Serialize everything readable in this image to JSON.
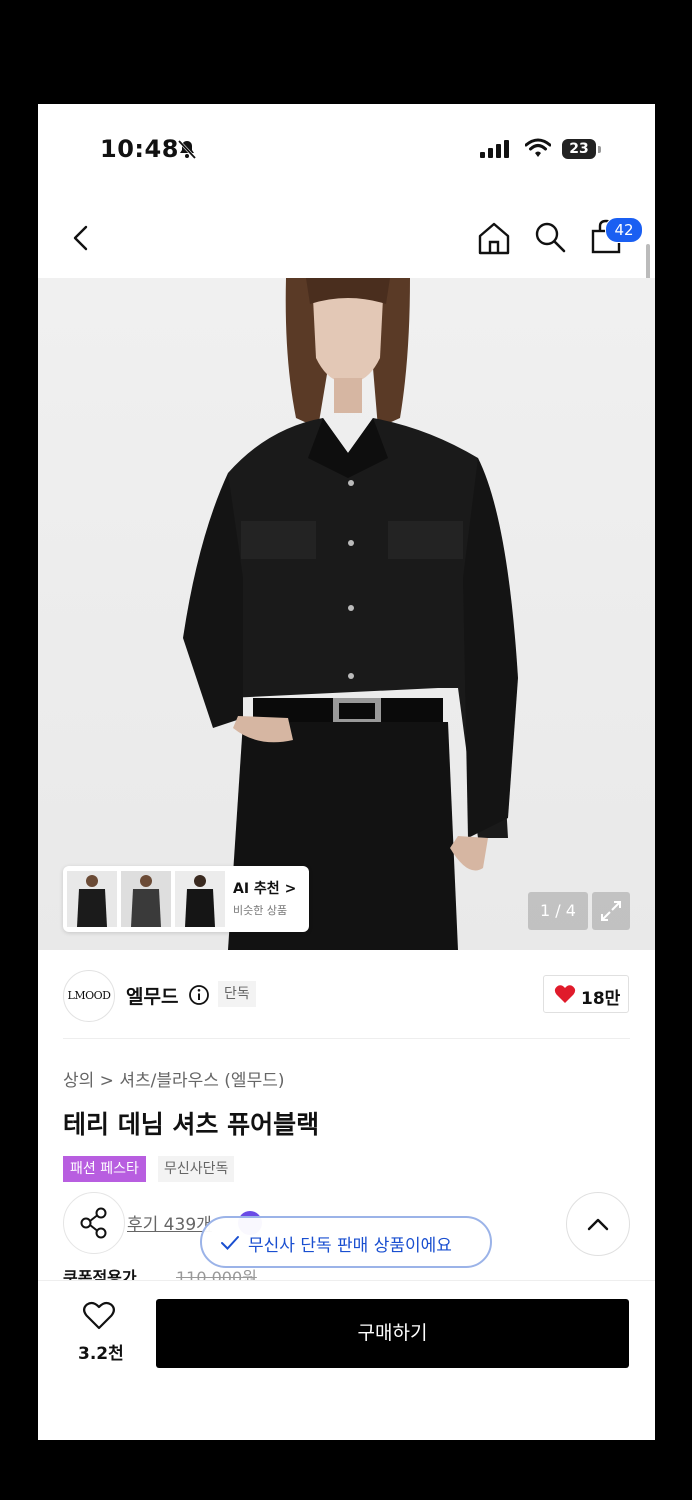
{
  "status_bar": {
    "time": "10:48",
    "battery": "23"
  },
  "nav": {
    "cart_count": "42"
  },
  "gallery": {
    "ai_title": "AI 추천",
    "ai_chevron": ">",
    "ai_subtitle": "비슷한 상품",
    "pager": "1 / 4"
  },
  "brand": {
    "logo_text": "LMOOD",
    "name": "엘무드",
    "tag": "단독",
    "likes": "18만"
  },
  "product": {
    "breadcrumb": "상의 > 셔츠/블라우스 (엘무드)",
    "title": "테리 데님 셔츠 퓨어블랙",
    "tag_fest": "패션 페스타",
    "tag_exclusive": "무신사단독",
    "reviews": "후기 439개",
    "coupon_label": "쿠폰적용가",
    "original_price": "110,000원"
  },
  "toast": {
    "text": "무신사 단독 판매 상품이에요"
  },
  "bottom": {
    "wish_count": "3.2천",
    "buy_label": "구매하기"
  },
  "colors": {
    "accent_blue": "#1a5ff2",
    "fest_purple": "#b85ee0",
    "like_red": "#e01b2b",
    "toast_blue": "#1a4fd0"
  }
}
